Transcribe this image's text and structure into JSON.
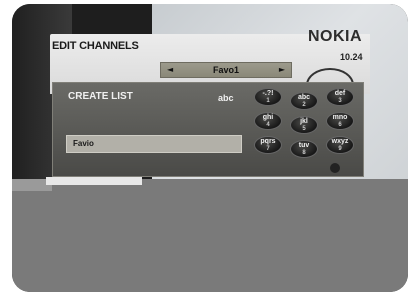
{
  "header": {
    "title": "EDIT CHANNELS",
    "brand": "NOKIA",
    "time": "10.24"
  },
  "selector": {
    "left_arrow": "◄",
    "label": "Favo1",
    "right_arrow": "►"
  },
  "panel": {
    "heading": "CREATE LIST",
    "mode": "abc",
    "name_value": "Favio"
  },
  "keypad": {
    "keys": [
      {
        "top": "-.?!",
        "sub": "1"
      },
      {
        "top": "abc",
        "sub": "2"
      },
      {
        "top": "def",
        "sub": "3"
      },
      {
        "top": "ghi",
        "sub": "4"
      },
      {
        "top": "jkl",
        "sub": "5"
      },
      {
        "top": "mno",
        "sub": "6"
      },
      {
        "top": "pqrs",
        "sub": "7"
      },
      {
        "top": "tuv",
        "sub": "8"
      },
      {
        "top": "wxyz",
        "sub": "9"
      }
    ]
  },
  "colors": {
    "panel": "#5a5a56",
    "field": "#b2b0a8",
    "selector": "#9c9a8c",
    "lower_area": "#7a7a7a"
  }
}
